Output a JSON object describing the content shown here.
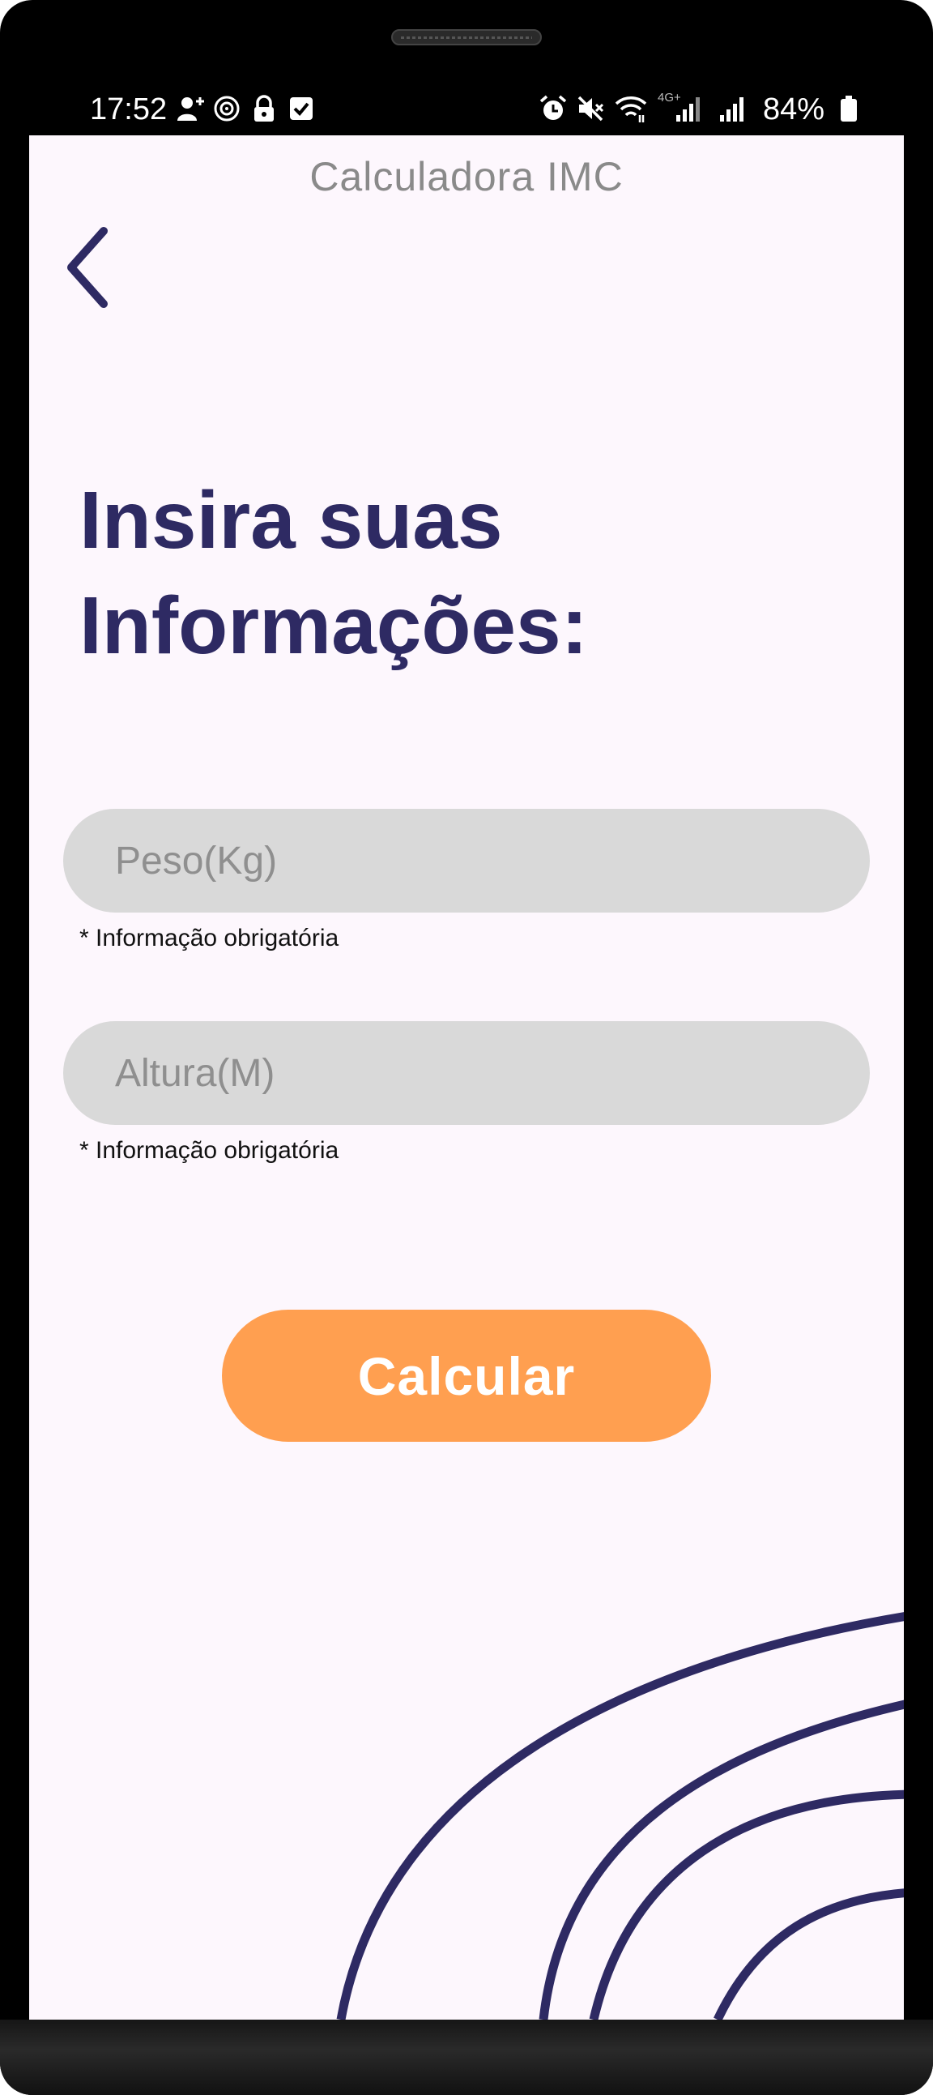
{
  "statusbar": {
    "time": "17:52",
    "battery": "84%",
    "network": "4G+"
  },
  "header": {
    "title": "Calculadora IMC",
    "back_icon": "chevron-left-icon"
  },
  "main": {
    "heading": "Insira suas Informações:",
    "fields": [
      {
        "placeholder": "Peso(Kg)",
        "value": "",
        "helper": "* Informação obrigatória"
      },
      {
        "placeholder": "Altura(M)",
        "value": "",
        "helper": "* Informação obrigatória"
      }
    ],
    "submit_label": "Calcular"
  },
  "colors": {
    "primary": "#2e2a63",
    "accent": "#ff9f50",
    "background": "#fdf7fd",
    "field": "#d9d9d9"
  }
}
